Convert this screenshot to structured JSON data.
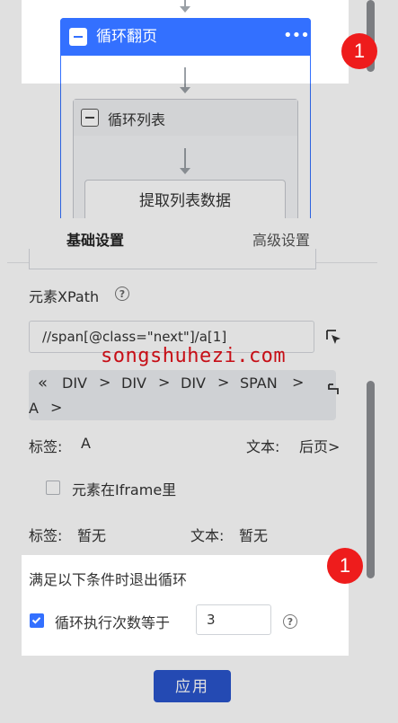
{
  "flow": {
    "loop_page_title": "循环翻页",
    "loop_page_more": "•••",
    "loop_list_title": "循环列表",
    "extract_title": "提取列表数据"
  },
  "tabs": [
    {
      "label": "基础设置",
      "active": true
    },
    {
      "label": "高级设置",
      "active": false
    }
  ],
  "element_xpath": {
    "label": "元素XPath",
    "value": "//span[@class=\"next\"]/a[1]"
  },
  "breadcrumbs": {
    "items": [
      "DIV",
      "DIV",
      "DIV",
      "SPAN",
      "A"
    ],
    "prev_icon": "double-chevron-left-icon",
    "sep_icon": "chevron-right-icon"
  },
  "element_info": {
    "tag_label": "标签:",
    "tag_value": "A",
    "text_label": "文本:",
    "text_value": "后页>"
  },
  "iframe_option": {
    "label": "元素在Iframe里",
    "checked": false
  },
  "iframe_info": {
    "tag_label": "标签:",
    "tag_value": "暂无",
    "text_label": "文本:",
    "text_value": "暂无"
  },
  "exit_condition": {
    "title": "满足以下条件时退出循环",
    "option_label": "循环执行次数等于",
    "checked": true,
    "count": "3"
  },
  "apply_label": "应用",
  "badges": [
    "1",
    "1"
  ],
  "watermark": "songshuhezi.com",
  "colors": {
    "accent": "#3370ff",
    "apply": "#2a55cc",
    "badge": "#ee1c1c"
  }
}
